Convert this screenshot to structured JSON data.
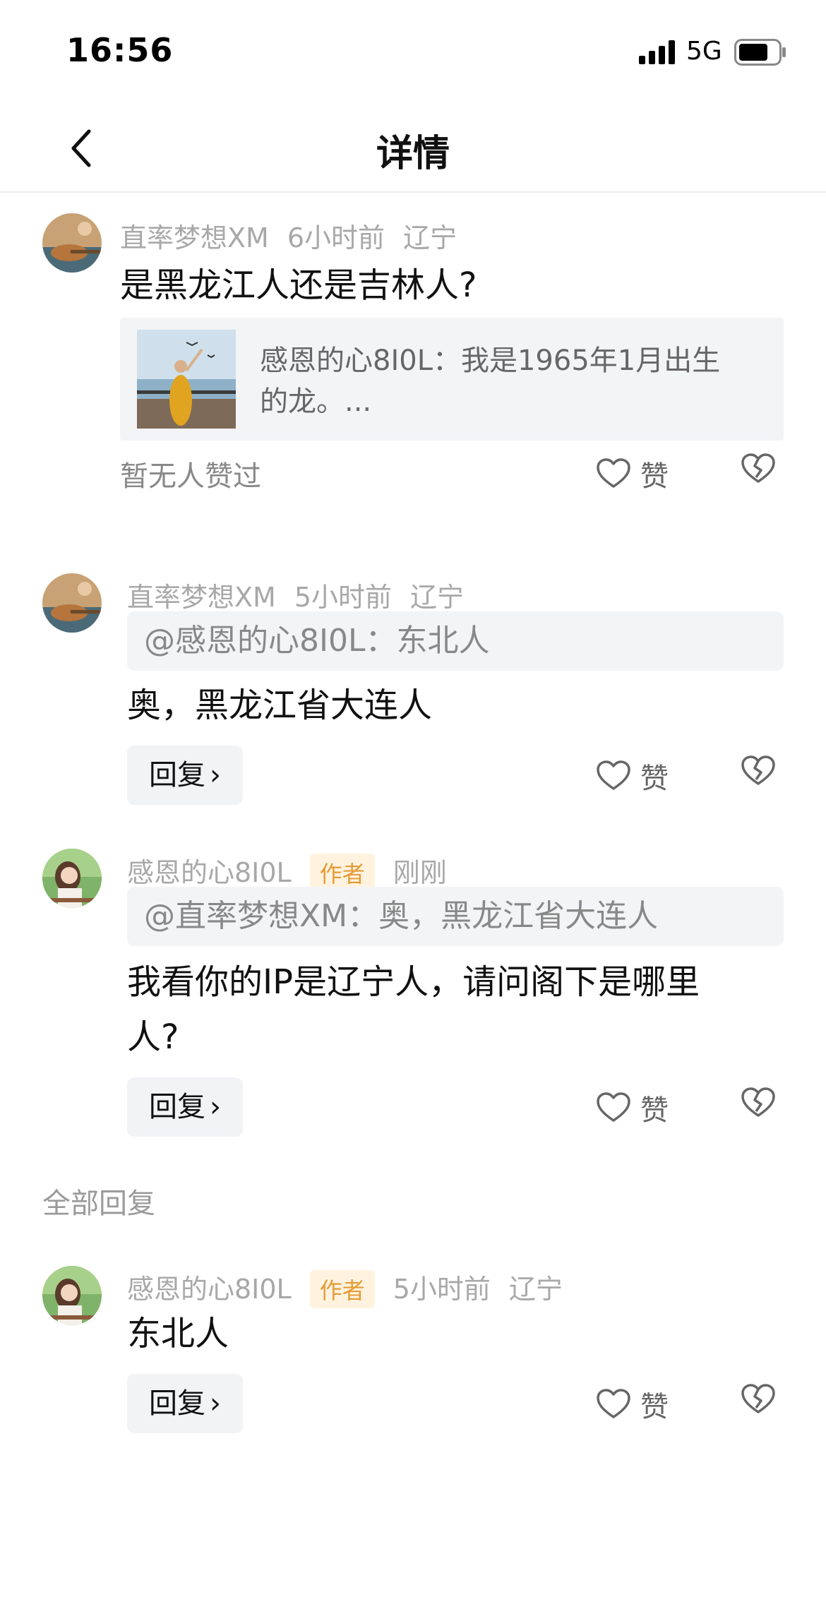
{
  "status": {
    "time": "16:56",
    "network": "5G"
  },
  "nav": {
    "title": "详情"
  },
  "main_comment": {
    "user": "直率梦想XM",
    "time": "6小时前",
    "location": "辽宁",
    "text": "是黑龙江人还是吉林人?",
    "ref_text_line1": "感恩的心8I0L：我是1965年1月出生",
    "ref_text_line2": "的龙。...",
    "no_likes": "暂无人赞过",
    "like_label": "赞"
  },
  "replies": [
    {
      "user": "直率梦想XM",
      "time": "5小时前",
      "location": "辽宁",
      "quote": "@感恩的心8I0L：东北人",
      "text": "奥，黑龙江省大连人",
      "reply_label": "回复",
      "like_label": "赞"
    },
    {
      "user": "感恩的心8I0L",
      "badge": "作者",
      "time": "刚刚",
      "quote": "@直率梦想XM：奥，黑龙江省大连人",
      "text_line1": "我看你的IP是辽宁人，请问阁下是哪里",
      "text_line2": "人?",
      "reply_label": "回复",
      "like_label": "赞"
    }
  ],
  "all_replies": {
    "section_label": "全部回复",
    "items": [
      {
        "user": "感恩的心8I0L",
        "badge": "作者",
        "time": "5小时前",
        "location": "辽宁",
        "text": "东北人",
        "reply_label": "回复",
        "like_label": "赞"
      }
    ]
  },
  "icons": {
    "back": "chevron-left-icon",
    "like": "heart-icon",
    "dislike": "broken-heart-icon",
    "reply_arrow": "chevron-right-icon"
  },
  "colors": {
    "badge_bg": "#fff3df",
    "badge_text": "#e59b35",
    "meta": "#a8a8a8",
    "bg_gray": "#f3f4f6"
  }
}
